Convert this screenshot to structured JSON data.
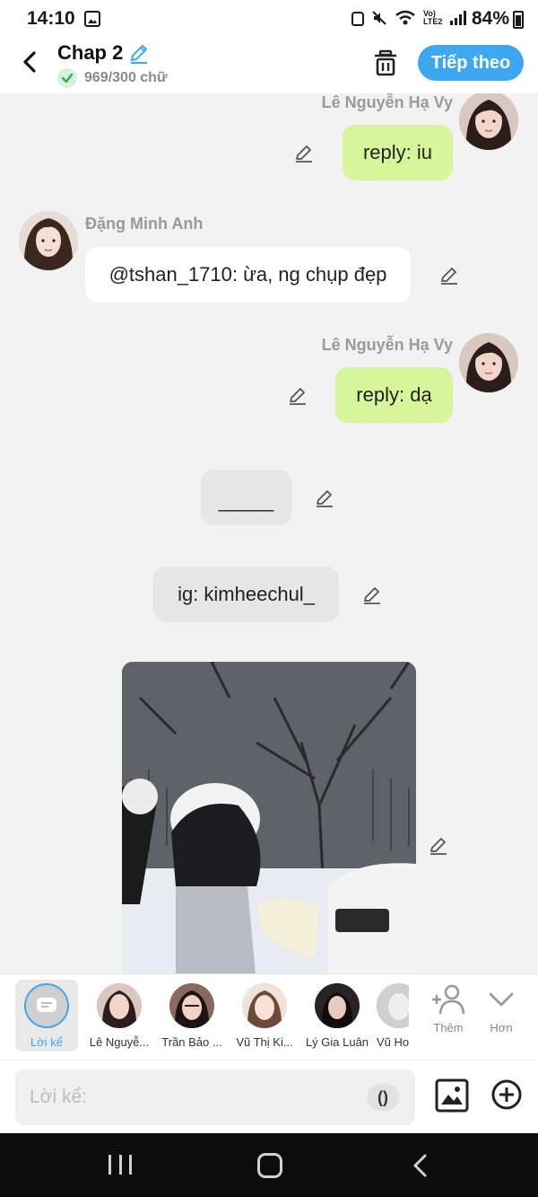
{
  "status_bar": {
    "time": "14:10",
    "lte": "Vo) LTE2",
    "battery": "84%"
  },
  "header": {
    "title": "Chap 2",
    "word_count": "969/300 chữ",
    "next_label": "Tiếp theo"
  },
  "messages": [
    {
      "sender": "Lê Nguyễn Hạ Vy",
      "text": "reply: iu"
    },
    {
      "sender": "Đặng Minh Anh",
      "text": "@tshan_1710: ừa, ng chụp đẹp"
    },
    {
      "sender": "Lê Nguyễn Hạ Vy",
      "text": "reply: dạ"
    },
    {
      "text": "_____"
    },
    {
      "text": "ig: kimheechul_"
    }
  ],
  "characters": [
    {
      "label": "Lời kể"
    },
    {
      "label": "Lê Nguyễ..."
    },
    {
      "label": "Trần Bảo ..."
    },
    {
      "label": "Vũ Thị Ki..."
    },
    {
      "label": "Lý Gia Luân"
    },
    {
      "label": "Vũ Ho"
    }
  ],
  "tools": {
    "add_label": "Thêm",
    "more_label": "Hơn"
  },
  "input": {
    "placeholder": "Lời kể:",
    "paren_label": "()"
  },
  "colors": {
    "accent": "#3da8f0",
    "bubble_right": "#d7f59a",
    "bubble_left": "#ffffff",
    "bubble_center": "#e6e6e6"
  }
}
